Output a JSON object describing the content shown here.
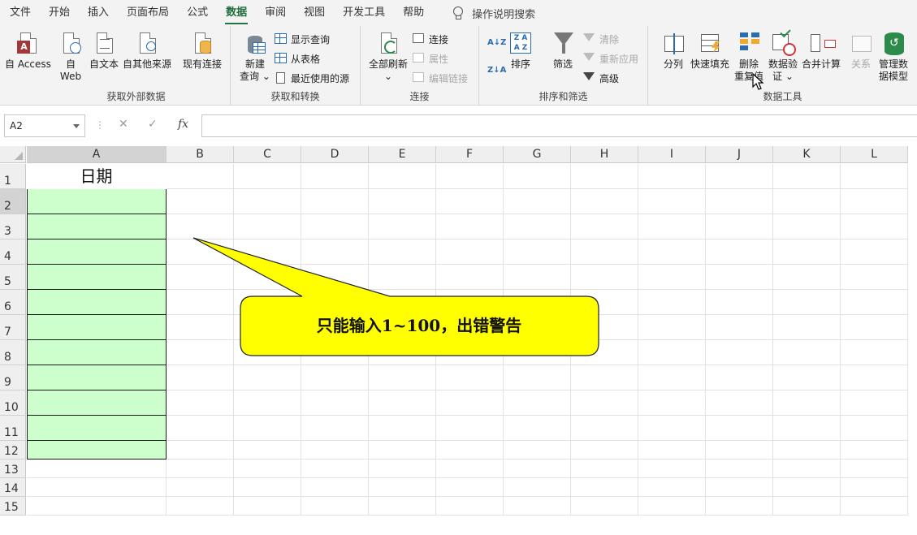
{
  "menu": {
    "tabs": [
      "文件",
      "开始",
      "插入",
      "页面布局",
      "公式",
      "数据",
      "审阅",
      "视图",
      "开发工具",
      "帮助"
    ],
    "active_tab": "数据",
    "tell_me": "操作说明搜索"
  },
  "ribbon": {
    "external_data": {
      "label": "获取外部数据",
      "access": "自 Access",
      "web_1": "自",
      "web_2": "Web",
      "text": "自文本",
      "other": "自其他来源",
      "existing": "现有连接"
    },
    "get_transform": {
      "label": "获取和转换",
      "new_query_1": "新建",
      "new_query_2": "查询",
      "show_queries": "显示查询",
      "from_table": "从表格",
      "recent_sources": "最近使用的源"
    },
    "connections": {
      "label": "连接",
      "refresh_all": "全部刷新",
      "connections": "连接",
      "properties": "属性",
      "edit_links": "编辑链接"
    },
    "sort_filter": {
      "label": "排序和筛选",
      "sort": "排序",
      "filter": "筛选",
      "clear": "清除",
      "reapply": "重新应用",
      "advanced": "高级"
    },
    "data_tools": {
      "label": "数据工具",
      "text_to_columns": "分列",
      "flash_fill": "快速填充",
      "remove_dup_1": "删除",
      "remove_dup_2": "重复值",
      "validation_1": "数据验",
      "validation_2": "证",
      "consolidate": "合并计算",
      "relationships": "关系",
      "manage_model_1": "管理数",
      "manage_model_2": "据模型"
    }
  },
  "formula_bar": {
    "name_box": "A2",
    "cancel": "✕",
    "enter": "✓",
    "fx": "fx",
    "value": ""
  },
  "sheet": {
    "columns": [
      "A",
      "B",
      "C",
      "D",
      "E",
      "F",
      "G",
      "H",
      "I",
      "J",
      "K",
      "L"
    ],
    "rows": [
      "1",
      "2",
      "3",
      "4",
      "5",
      "6",
      "7",
      "8",
      "9",
      "10",
      "11",
      "12",
      "13",
      "14",
      "15"
    ],
    "a1": "日期",
    "callout_text": "只能输入1~100，出错警告",
    "colors": {
      "green_fill": "#ccffcc",
      "callout_fill": "#ffff00",
      "accent": "#217346"
    }
  }
}
